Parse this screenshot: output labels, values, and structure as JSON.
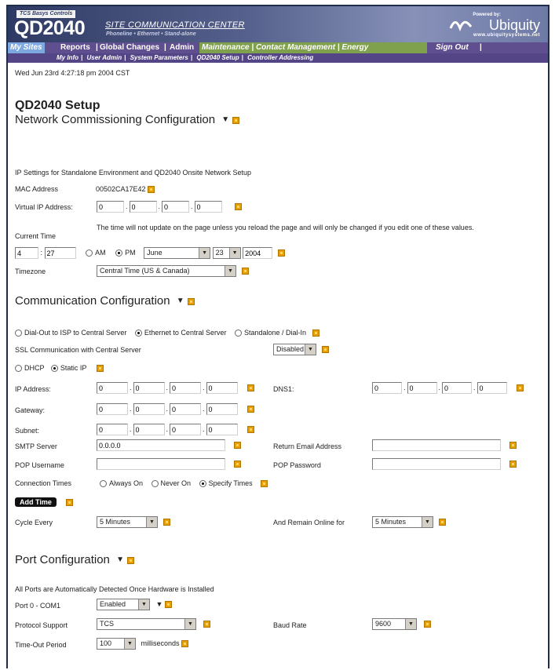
{
  "header": {
    "tcs_tag": "TCS Basys Controls",
    "product": "QD2040",
    "site_title": "SITE COMMUNICATION CENTER",
    "site_sub": "Phoneline  •  Ethernet  •  Stand-alone",
    "brand_powered": "Powered by:",
    "brand_name": "Ubiquity",
    "brand_url": "www.ubiquitysystems.net"
  },
  "nav": {
    "items": [
      "My Sites",
      "Reports",
      "Global Changes",
      "Admin",
      "Maintenance",
      "Contact Management",
      "Energy",
      "Sign Out"
    ],
    "sub_items": [
      "My Info",
      "User Admin",
      "System Parameters",
      "QD2040 Setup",
      "Controller Addressing"
    ]
  },
  "datetime": "Wed Jun 23rd 4:27:18 pm 2004 CST",
  "page_title": "QD2040 Setup",
  "network": {
    "title": "Network Commissioning Configuration",
    "intro": "IP Settings for Standalone Environment and QD2040 Onsite Network Setup",
    "mac_label": "MAC Address",
    "mac_value": "00502CA17E42",
    "vip_label": "Virtual IP Address:",
    "vip": [
      "0",
      "0",
      "0",
      "0"
    ],
    "time_label": "Current Time",
    "time_note": "The time will not update on the page unless you reload the page and will only be changed if you edit one of these values.",
    "hour": "4",
    "minute": "27",
    "am": "AM",
    "pm": "PM",
    "month": "June",
    "day": "23",
    "year": "2004",
    "tz_label": "Timezone",
    "tz_value": "Central Time (US & Canada)"
  },
  "comm": {
    "title": "Communication Configuration",
    "opt_dialout": "Dial-Out to ISP to Central Server",
    "opt_ethernet": "Ethernet to Central Server",
    "opt_standalone": "Standalone / Dial-In",
    "ssl_label": "SSL Communication with Central Server",
    "ssl_value": "Disabled",
    "dhcp": "DHCP",
    "static": "Static IP",
    "ip_label": "IP Address:",
    "ip": [
      "0",
      "0",
      "0",
      "0"
    ],
    "dns_label": "DNS1:",
    "dns": [
      "0",
      "0",
      "0",
      "0"
    ],
    "gw_label": "Gateway:",
    "gw": [
      "0",
      "0",
      "0",
      "0"
    ],
    "subnet_label": "Subnet:",
    "subnet": [
      "0",
      "0",
      "0",
      "0"
    ],
    "smtp_label": "SMTP Server",
    "smtp_value": "0.0.0.0",
    "return_label": "Return Email Address",
    "return_value": "",
    "popuser_label": "POP Username",
    "popuser_value": "",
    "poppass_label": "POP Password",
    "poppass_value": "",
    "conn_label": "Connection Times",
    "conn_always": "Always On",
    "conn_never": "Never On",
    "conn_specify": "Specify Times",
    "add_time": "Add Time",
    "cycle_label": "Cycle Every",
    "cycle_value": "5 Minutes",
    "remain_label": "And Remain Online for",
    "remain_value": "5 Minutes"
  },
  "port": {
    "title": "Port Configuration",
    "intro": "All Ports are Automatically Detected Once Hardware is Installed",
    "port0_label": "Port 0 - COM1",
    "port0_value": "Enabled",
    "protocol_label": "Protocol Support",
    "protocol_value": "TCS",
    "baud_label": "Baud Rate",
    "baud_value": "9600",
    "timeout_label": "Time-Out Period",
    "timeout_value": "100",
    "timeout_unit": "milliseconds"
  },
  "colors": {
    "banner": "#2e3a63",
    "nav_bg": "#5f4f8f",
    "nav_active": "#7ea8e0",
    "nav_maint": "#7fa04d",
    "help_icon": "#e5a000"
  }
}
